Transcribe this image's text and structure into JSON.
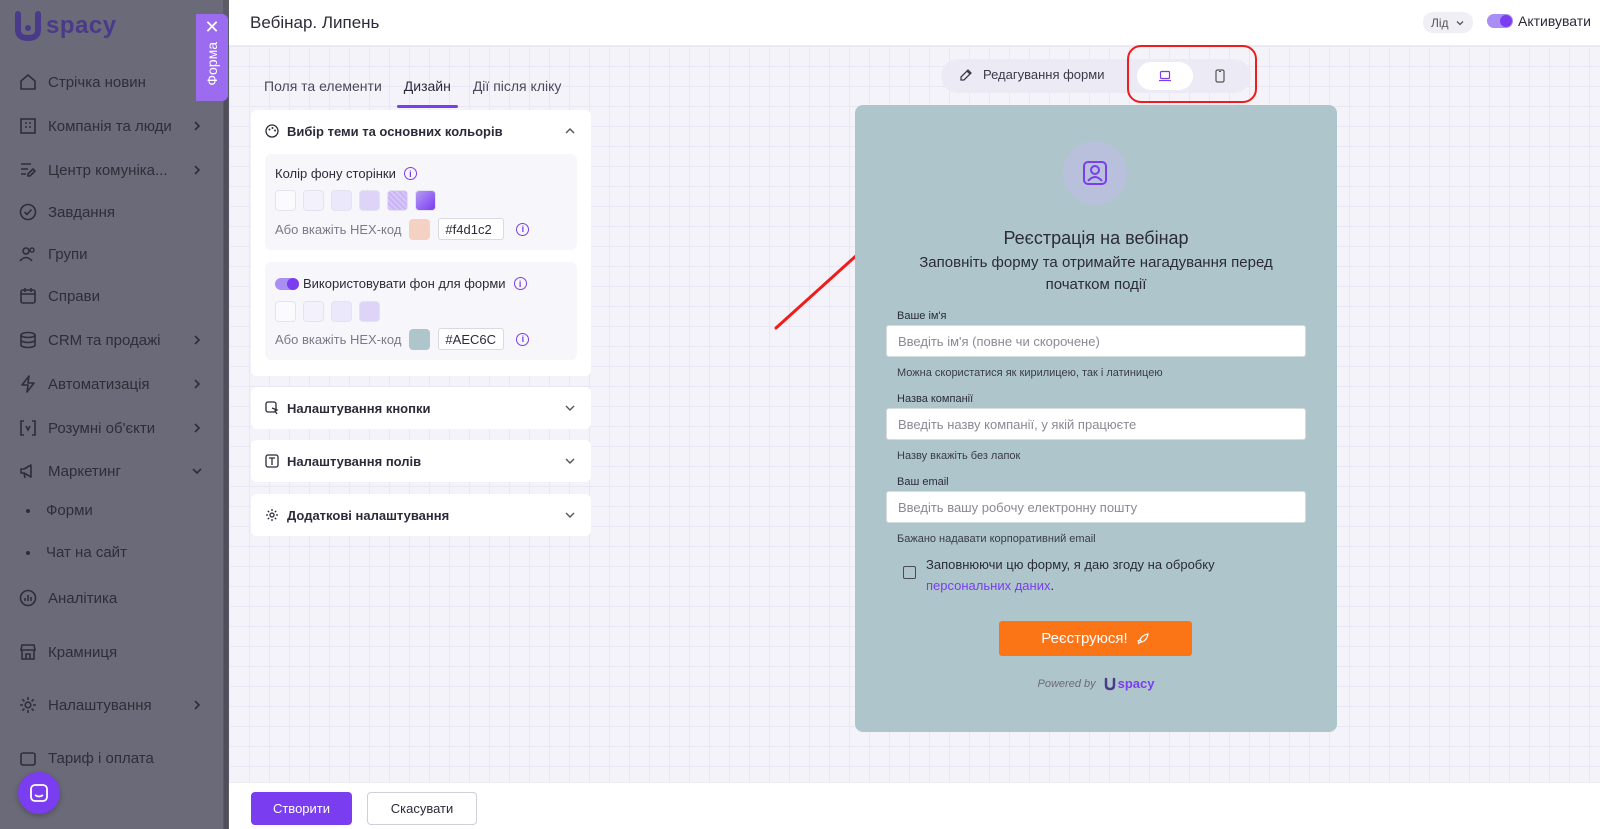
{
  "sidebar": {
    "logo_text": "spacy",
    "forma_tab_label": "Форма",
    "items": [
      {
        "label": "Стрічка новин",
        "icon": "home-icon",
        "has_chevron": false
      },
      {
        "label": "Компанія та люди",
        "icon": "building-icon",
        "has_chevron": true
      },
      {
        "label": "Центр комуніка...",
        "icon": "chat-edit-icon",
        "has_chevron": true
      },
      {
        "label": "Завдання",
        "icon": "check-circle-icon",
        "has_chevron": false
      },
      {
        "label": "Групи",
        "icon": "users-icon",
        "has_chevron": false
      },
      {
        "label": "Справи",
        "icon": "calendar-icon",
        "has_chevron": false
      },
      {
        "label": "CRM та продажі",
        "icon": "database-icon",
        "has_chevron": true
      },
      {
        "label": "Автоматизація",
        "icon": "lightning-icon",
        "has_chevron": true
      },
      {
        "label": "Розумні об'єкти",
        "icon": "brackets-icon",
        "has_chevron": true
      },
      {
        "label": "Маркетинг",
        "icon": "megaphone-icon",
        "has_chevron": true
      },
      {
        "label": "Аналітика",
        "icon": "chart-icon",
        "has_chevron": false
      },
      {
        "label": "Крамниця",
        "icon": "store-icon",
        "has_chevron": false
      },
      {
        "label": "Налаштування",
        "icon": "gear-icon",
        "has_chevron": true
      },
      {
        "label": "Тариф і оплата",
        "icon": "wallet-icon",
        "has_chevron": false
      }
    ],
    "sub_items": [
      "Форми",
      "Чат на сайт"
    ]
  },
  "topbar": {
    "title": "Вебінар. Липень",
    "entity_select": "Лід",
    "activate_label": "Активувати"
  },
  "tabs": [
    {
      "label": "Поля та елементи",
      "active": false
    },
    {
      "label": "Дизайн",
      "active": true
    },
    {
      "label": "Дії після кліку",
      "active": false
    }
  ],
  "design": {
    "theme_section": "Вибір теми та основних кольорів",
    "page_bg_label": "Колір фону сторінки",
    "hex_label": "Або вкажіть HEX-код",
    "page_bg_hex": "#f4d1c2",
    "page_bg_swatch_color": "#f4d1c2",
    "use_form_bg_label": "Використовувати фон для форми",
    "form_bg_hex": "#AEC6C",
    "form_bg_swatch_color": "#aec6cb",
    "button_section": "Налаштування кнопки",
    "fields_section": "Налаштування полів",
    "extra_section": "Додаткові налаштування"
  },
  "preview_toolbar": {
    "edit_label": "Редагування форми"
  },
  "form": {
    "title": "Реєстрація на вебінар",
    "subtitle": "Заповніть форму та отримайте нагадування перед початком події",
    "fields": [
      {
        "label": "Ваше ім'я",
        "placeholder": "Введіть ім'я (повне чи скорочене)",
        "hint": "Можна скористатися як кирилицею, так і латиницею"
      },
      {
        "label": "Назва компанії",
        "placeholder": "Введіть назву компанії, у якій працюєте",
        "hint": "Назву вкажіть без лапок"
      },
      {
        "label": "Ваш email",
        "placeholder": "Введіть вашу робочу електронну пошту",
        "hint": "Бажано надавати корпоративний email"
      }
    ],
    "consent_text": "Заповнюючи цю форму, я даю згоду на обробку",
    "consent_link": "персональних даних",
    "consent_end": ".",
    "submit_label": "Реєструюся!",
    "powered_by": "Powered by",
    "powered_logo": "spacy"
  },
  "footer": {
    "create_label": "Створити",
    "cancel_label": "Скасувати"
  },
  "colors": {
    "accent": "#7a3df0",
    "submit": "#fb7517",
    "form_bg": "#aec6cb",
    "highlight": "#ee1c1c"
  }
}
